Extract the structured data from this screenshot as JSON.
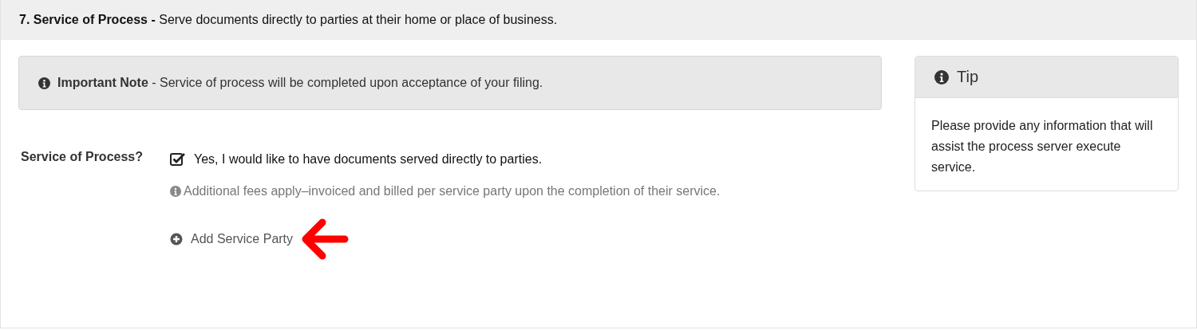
{
  "section": {
    "title": "**7. Service of Process -** Serve documents directly to parties at their home or place of business."
  },
  "note": {
    "text": "**Important Note** - Service of process will be completed upon acceptance of your filing."
  },
  "field": {
    "label": "Service of Process?",
    "checkbox": {
      "label": "Yes, I would like to have documents served directly to parties.",
      "checked": true
    },
    "help": "Additional fees apply–invoiced and billed per service party upon the completion of their service.",
    "add_link": "Add Service Party"
  },
  "tip": {
    "title": "Tip",
    "body": "Please provide any information that will assist the process server execute service."
  }
}
